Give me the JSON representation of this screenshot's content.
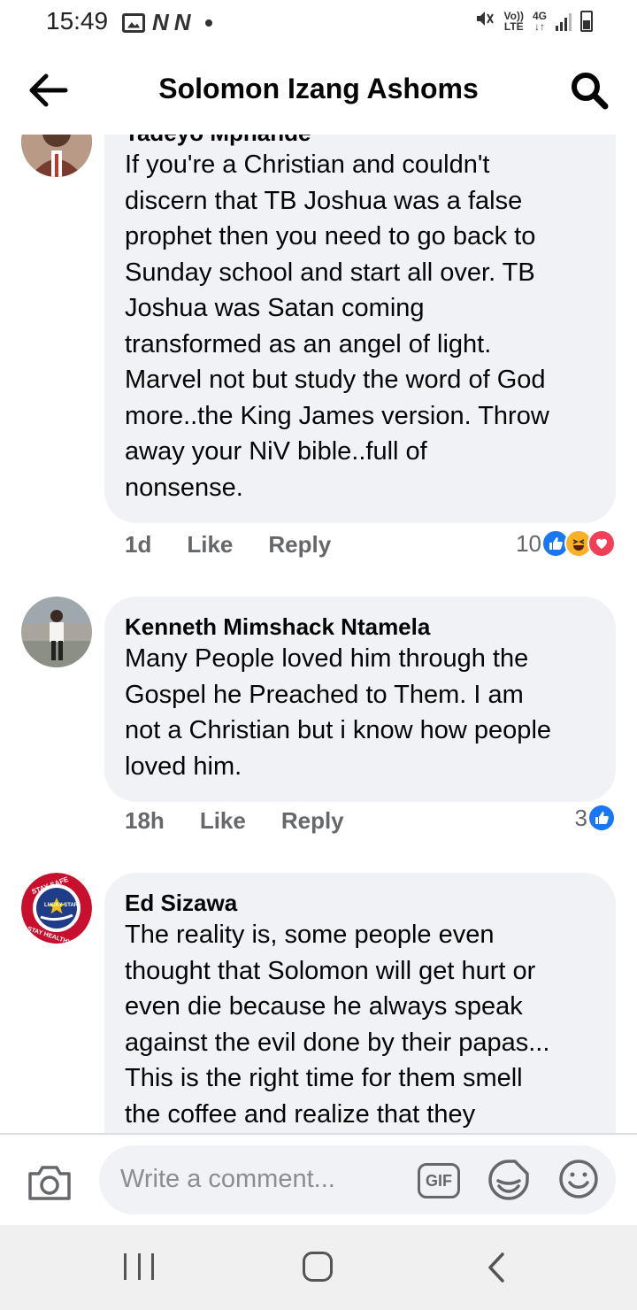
{
  "status_bar": {
    "time": "15:49",
    "network_type": "4G",
    "volte_label": "Vo))",
    "lte_label": "LTE",
    "icons": [
      "gallery-icon",
      "app-n-icon",
      "app-n-icon",
      "dot-icon",
      "mute-icon",
      "signal-icon",
      "battery-icon"
    ]
  },
  "header": {
    "title": "Solomon Izang Ashoms",
    "back_icon": "back-arrow-icon",
    "search_icon": "search-icon"
  },
  "comments": [
    {
      "author": "Tadeyo Mphande",
      "text": "If you're a Christian and couldn't\ndiscern that TB Joshua was a false\nprophet then you need to go  back to\nSunday school and start all over. TB\nJoshua was Satan coming\ntransformed as an angel of light.\nMarvel not but study the word of God\nmore..the King James version. Throw\naway your NiV bible..full of\nnonsense.",
      "time": "1d",
      "like_label": "Like",
      "reply_label": "Reply",
      "reaction_count": "10",
      "reactions": [
        "like",
        "haha",
        "love"
      ]
    },
    {
      "author": "Kenneth Mimshack Ntamela",
      "text": "Many People loved him through the\nGospel he Preached to Them. I am\nnot a Christian but i know how people\nloved him.",
      "time": "18h",
      "like_label": "Like",
      "reply_label": "Reply",
      "reaction_count": "3",
      "reactions": [
        "like"
      ]
    },
    {
      "author": "Ed Sizawa",
      "text": "The reality is, some people even\nthought that Solomon will get hurt or\neven die because he always speak\nagainst the evil done by their papas...\nThis is the right time for them smell\nthe coffee and realize that they",
      "avatar_logo_text": [
        "STAY SAFE",
        "LUCKY STAR",
        "STAY HEALTHY"
      ]
    }
  ],
  "comment_bar": {
    "placeholder": "Write a comment...",
    "gif_label": "GIF",
    "icons": [
      "camera-icon",
      "gif-icon",
      "sticker-icon",
      "emoji-icon"
    ]
  },
  "nav_bar": {
    "icons": [
      "recent-apps-icon",
      "home-icon",
      "back-icon"
    ]
  },
  "colors": {
    "bubble": "#f0f2f5",
    "secondary_text": "#65676b",
    "like_blue": "#1877f2",
    "haha_yellow": "#f7b125",
    "love_red": "#f33e58"
  }
}
